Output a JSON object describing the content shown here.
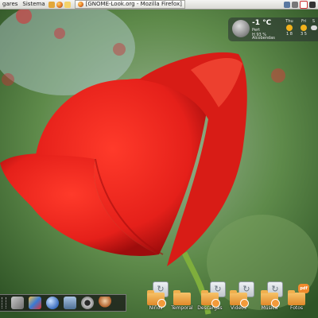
{
  "top_panel": {
    "menus": [
      "gares",
      "Sistema"
    ],
    "task_title": "[GNOME-Look.org - Mozilla Firefox]"
  },
  "weather": {
    "temperature": "-1 °C",
    "condition": "Pert",
    "humidity": "H 93 %",
    "location": "Alcobendas",
    "forecast": [
      {
        "day": "Thu",
        "temps": "1  8"
      },
      {
        "day": "Fri",
        "temps": "3  5"
      },
      {
        "day": "S",
        "temps": ""
      }
    ]
  },
  "desktop_icons": [
    {
      "label": "Niños",
      "badge": ""
    },
    {
      "label": "Temporal",
      "badge": ""
    },
    {
      "label": "Descargas",
      "badge": ""
    },
    {
      "label": "Videos",
      "badge": ""
    },
    {
      "label": "Música",
      "badge": ""
    },
    {
      "label": "Fotos",
      "badge": "pdf"
    }
  ],
  "colors": {
    "panel": "#e8e8e4",
    "poppy": "#e8241a",
    "folder": "#e9a23e",
    "dock": "#1e1e1e"
  }
}
